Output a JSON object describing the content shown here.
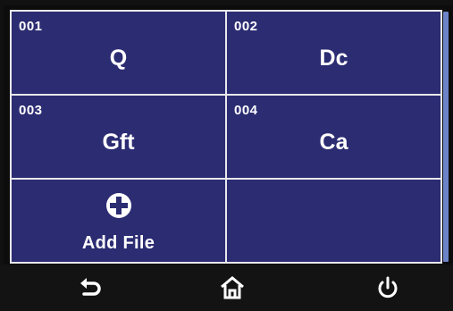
{
  "files": [
    {
      "number": "001",
      "name": "Q"
    },
    {
      "number": "002",
      "name": "Dc"
    },
    {
      "number": "003",
      "name": "Gft"
    },
    {
      "number": "004",
      "name": "Ca"
    }
  ],
  "add_file": {
    "label": "Add File",
    "icon": "plus-circle-icon"
  },
  "nav": {
    "back_icon": "back-arrow-icon",
    "home_icon": "home-icon",
    "power_icon": "power-icon"
  },
  "colors": {
    "cell_background": "#2c2c73",
    "grid_lines": "#e8e8ec",
    "scrollbar": "#6d83c7",
    "bottom_bar": "#131313",
    "text": "#ffffff"
  }
}
